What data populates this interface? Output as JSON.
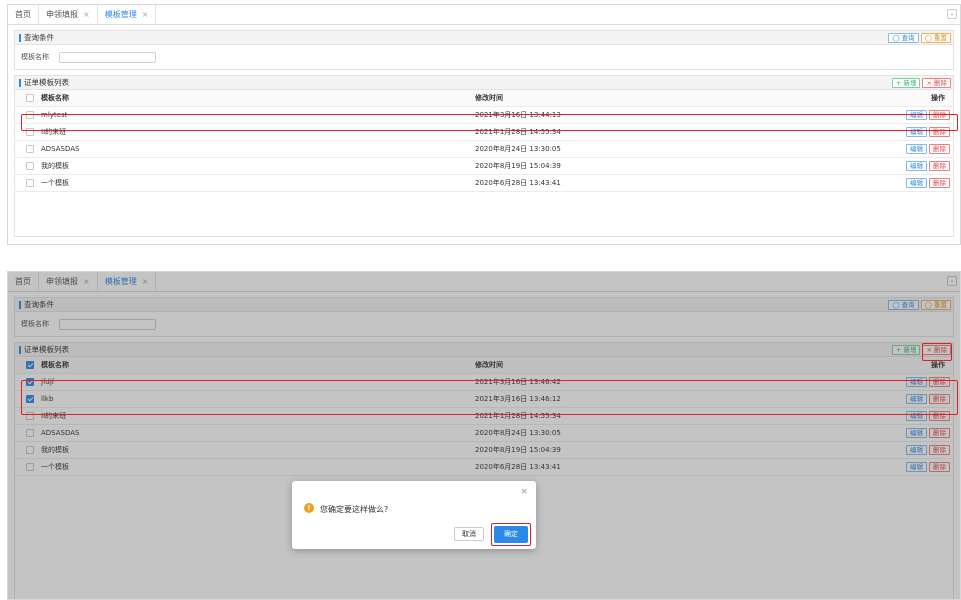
{
  "tabs": [
    {
      "label": "首页",
      "closable": false
    },
    {
      "label": "申领填报",
      "closable": true
    },
    {
      "label": "模板管理",
      "closable": true
    }
  ],
  "tab_close": "×",
  "tab_menu": "⌄",
  "query": {
    "title": "查询条件",
    "search_button": "◯ 查询",
    "reset_button": "◯ 重置",
    "field_label": "模板名称",
    "field_value": ""
  },
  "list": {
    "title": "证单模板列表",
    "add_button": "+ 新增",
    "delete_button": "× 删除",
    "col_name": "模板名称",
    "col_time": "修改时间",
    "col_ops": "操作",
    "edit_label": "编辑",
    "delete_label": "删除"
  },
  "screen1": {
    "rows": [
      {
        "name": "mlytest",
        "time": "2021年3月16日 13:44:13",
        "checked": false
      },
      {
        "name": "II的末班",
        "time": "2021年1月28日 14:55:34",
        "checked": false
      },
      {
        "name": "ADSASDAS",
        "time": "2020年8月24日 13:30:05",
        "checked": false
      },
      {
        "name": "我的模板",
        "time": "2020年8月19日 15:04:39",
        "checked": false
      },
      {
        "name": "一个模板",
        "time": "2020年6月28日 13:43:41",
        "checked": false
      }
    ]
  },
  "screen2": {
    "rows": [
      {
        "name": "jfdjf",
        "time": "2021年3月16日 13:46:42",
        "checked": true
      },
      {
        "name": "llkb",
        "time": "2021年3月16日 13:46:12",
        "checked": true
      },
      {
        "name": "II的末班",
        "time": "2021年1月28日 14:55:34",
        "checked": false
      },
      {
        "name": "ADSASDAS",
        "time": "2020年8月24日 13:30:05",
        "checked": false
      },
      {
        "name": "我的模板",
        "time": "2020年8月19日 15:04:39",
        "checked": false
      },
      {
        "name": "一个模板",
        "time": "2020年6月28日 13:43:41",
        "checked": false
      }
    ]
  },
  "dialog": {
    "message": "您确定要这样做么?",
    "cancel": "取消",
    "confirm": "确定",
    "close": "×",
    "warn_icon": "!"
  },
  "colors": {
    "accent": "#2b8ae8",
    "danger": "#e04848",
    "highlight": "#e02020",
    "warning": "#f0a020"
  }
}
